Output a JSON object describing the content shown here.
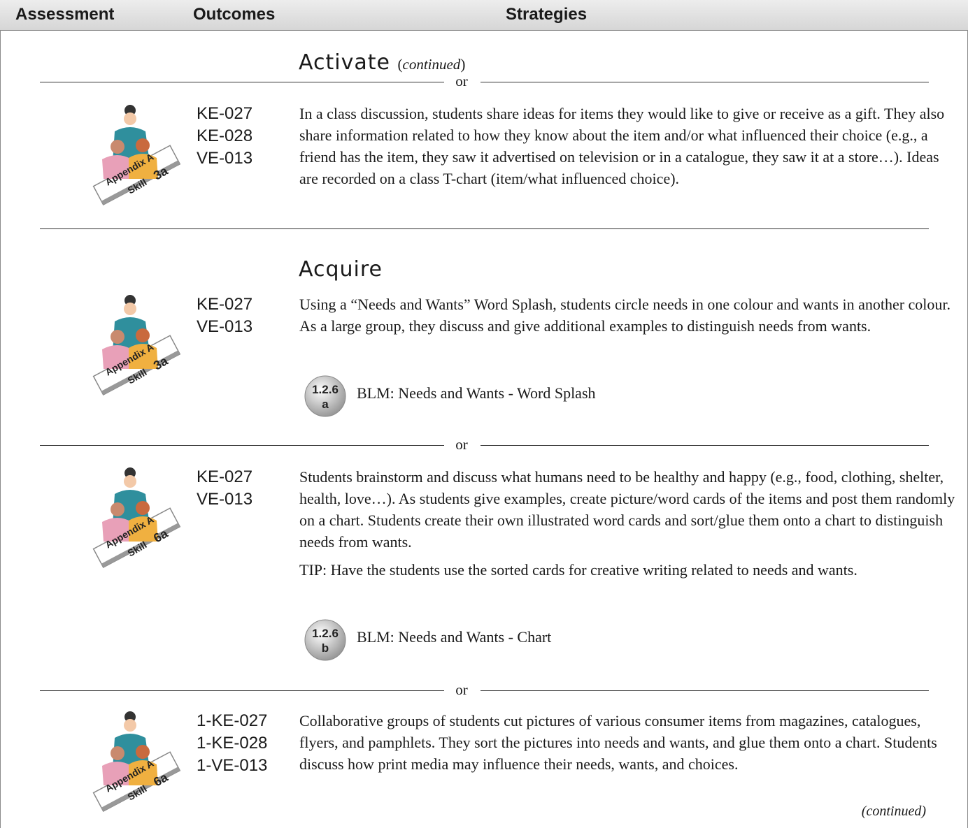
{
  "header": {
    "assessment": "Assessment",
    "outcomes": "Outcomes",
    "strategies": "Strategies"
  },
  "activate": {
    "heading": "Activate",
    "continued": "continued",
    "or": "or",
    "outcomes": [
      "KE-027",
      "KE-028",
      "VE-013"
    ],
    "text": "In a class discussion, students share ideas for items they would like to give or receive as a gift. They also share information related to how they know about the item and/or what influenced their choice (e.g., a friend has the item, they saw it advertised on television or in a catalogue, they saw it at a store…). Ideas are recorded on a class T-chart (item/what influenced choice).",
    "icon": {
      "name": "teacher-students-icon",
      "line1": "Appendix A",
      "line2": "Skill",
      "skill": "3a"
    }
  },
  "acquire": {
    "heading": "Acquire",
    "strategies": [
      {
        "outcomes": [
          "KE-027",
          "VE-013"
        ],
        "text": "Using a “Needs and Wants” Word Splash, students circle needs in one colour and wants in another colour. As a large group, they discuss and give additional examples to distinguish needs from wants.",
        "blm_code_top": "1.2.6",
        "blm_code_bottom": "a",
        "blm_label": "BLM: Needs and Wants - Word Splash",
        "icon": {
          "name": "teacher-students-icon",
          "line1": "Appendix A",
          "line2": "Skill",
          "skill": "3a"
        }
      },
      {
        "or": "or",
        "outcomes": [
          "KE-027",
          "VE-013"
        ],
        "text": "Students brainstorm and discuss what humans need to be healthy and happy (e.g., food, clothing, shelter, health, love…). As students give examples, create picture/word cards of the items and post them randomly on a chart. Students create their own illustrated word cards and sort/glue them onto a chart to distinguish needs from wants.",
        "tip": "TIP: Have the students use the sorted cards for creative writing related to needs and wants.",
        "blm_code_top": "1.2.6",
        "blm_code_bottom": "b",
        "blm_label": "BLM: Needs and Wants - Chart",
        "icon": {
          "name": "teacher-students-icon",
          "line1": "Appendix A",
          "line2": "Skill",
          "skill": "6a"
        }
      },
      {
        "or": "or",
        "outcomes": [
          "1-KE-027",
          "1-KE-028",
          "1-VE-013"
        ],
        "text": "Collaborative groups of students cut pictures of various consumer items from magazines, catalogues, flyers, and pamphlets. They sort the pictures into needs and wants, and glue them onto a chart. Students discuss how print media may influence their needs, wants, and choices.",
        "icon": {
          "name": "teacher-students-icon",
          "line1": "Appendix A",
          "line2": "Skill",
          "skill": "6a"
        }
      }
    ]
  },
  "footer": {
    "continued": "continued"
  },
  "colors": {
    "header_bg": "#dcdcdc",
    "teal": "#2f8f9d",
    "pink": "#e8a0b8",
    "orange": "#f0b040"
  }
}
